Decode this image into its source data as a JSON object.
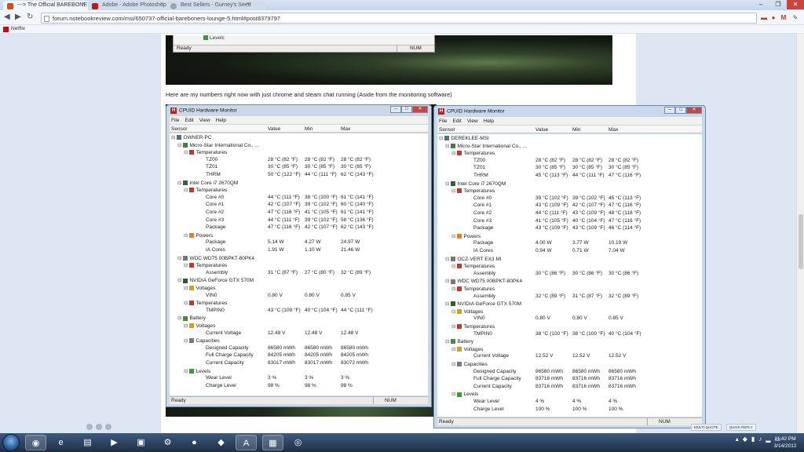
{
  "browser": {
    "tabs": [
      {
        "label": "---> The Official BAREBONE"
      },
      {
        "label": "Adobe - Adobe Photoshop"
      },
      {
        "label": "Best Sellers - Gurney's Seed"
      }
    ],
    "url": "forum.notebookreview.com/msi/650737-official-bareboners-lounge-5.html#post8379797",
    "bookmark": "Netflix"
  },
  "top_window": {
    "tree_item": "Levels",
    "status": "Ready",
    "num": "NUM"
  },
  "post_text": "Here are my numbers right now with just chrome and steam chat running (Aside from the monitoring software)",
  "hwm_title": "CPUID Hardware Monitor",
  "menu": [
    "File",
    "Edit",
    "View",
    "Help"
  ],
  "columns": {
    "sensor": "Sensor",
    "value": "Value",
    "min": "Min",
    "max": "Max"
  },
  "left_monitor": {
    "status": "Ready",
    "num": "NUM",
    "rows": [
      {
        "l": 0,
        "icon": "pc",
        "name": "OWNER-PC",
        "v": "",
        "mn": "",
        "mx": ""
      },
      {
        "l": 1,
        "icon": "mb",
        "name": "Micro-Star International Co., ...",
        "v": "",
        "mn": "",
        "mx": ""
      },
      {
        "l": 2,
        "icon": "temp",
        "name": "Temperatures",
        "v": "",
        "mn": "",
        "mx": ""
      },
      {
        "l": 3,
        "icon": "",
        "name": "TZ00",
        "v": "28 °C  (82 °F)",
        "mn": "28 °C  (82 °F)",
        "mx": "28 °C  (82 °F)"
      },
      {
        "l": 3,
        "icon": "",
        "name": "TZ01",
        "v": "30 °C  (85 °F)",
        "mn": "30 °C  (85 °F)",
        "mx": "30 °C  (85 °F)"
      },
      {
        "l": 3,
        "icon": "",
        "name": "THRM",
        "v": "50 °C  (122 °F)",
        "mn": "44 °C  (111 °F)",
        "mx": "62 °C  (143 °F)"
      },
      {
        "l": 1,
        "icon": "cpu",
        "name": "Intel Core i7 2670QM",
        "v": "",
        "mn": "",
        "mx": ""
      },
      {
        "l": 2,
        "icon": "temp",
        "name": "Temperatures",
        "v": "",
        "mn": "",
        "mx": ""
      },
      {
        "l": 3,
        "icon": "",
        "name": "Core #0",
        "v": "44 °C  (111 °F)",
        "mn": "38 °C  (100 °F)",
        "mx": "61 °C  (141 °F)"
      },
      {
        "l": 3,
        "icon": "",
        "name": "Core #1",
        "v": "42 °C  (107 °F)",
        "mn": "39 °C  (102 °F)",
        "mx": "60 °C  (140 °F)"
      },
      {
        "l": 3,
        "icon": "",
        "name": "Core #2",
        "v": "47 °C  (116 °F)",
        "mn": "41 °C  (105 °F)",
        "mx": "61 °C  (141 °F)"
      },
      {
        "l": 3,
        "icon": "",
        "name": "Core #3",
        "v": "44 °C  (111 °F)",
        "mn": "39 °C  (102 °F)",
        "mx": "58 °C  (136 °F)"
      },
      {
        "l": 3,
        "icon": "",
        "name": "Package",
        "v": "47 °C  (116 °F)",
        "mn": "42 °C  (107 °F)",
        "mx": "62 °C  (143 °F)"
      },
      {
        "l": 2,
        "icon": "power",
        "name": "Powers",
        "v": "",
        "mn": "",
        "mx": ""
      },
      {
        "l": 3,
        "icon": "",
        "name": "Package",
        "v": "5.14 W",
        "mn": "4.27 W",
        "mx": "24.97 W"
      },
      {
        "l": 3,
        "icon": "",
        "name": "IA Cores",
        "v": "1.91 W",
        "mn": "1.10 W",
        "mx": "21.46 W"
      },
      {
        "l": 1,
        "icon": "hdd",
        "name": "WDC WD75 00BPKT-80PK4",
        "v": "",
        "mn": "",
        "mx": ""
      },
      {
        "l": 2,
        "icon": "temp",
        "name": "Temperatures",
        "v": "",
        "mn": "",
        "mx": ""
      },
      {
        "l": 3,
        "icon": "",
        "name": "Assembly",
        "v": "31 °C  (87 °F)",
        "mn": "27 °C  (80 °F)",
        "mx": "32 °C  (89 °F)"
      },
      {
        "l": 1,
        "icon": "gpu",
        "name": "NVIDIA GeForce GTX 570M",
        "v": "",
        "mn": "",
        "mx": ""
      },
      {
        "l": 2,
        "icon": "volt",
        "name": "Voltages",
        "v": "",
        "mn": "",
        "mx": ""
      },
      {
        "l": 3,
        "icon": "",
        "name": "VIN0",
        "v": "0.80 V",
        "mn": "0.80 V",
        "mx": "0.85 V"
      },
      {
        "l": 2,
        "icon": "temp",
        "name": "Temperatures",
        "v": "",
        "mn": "",
        "mx": ""
      },
      {
        "l": 3,
        "icon": "",
        "name": "TMPIN0",
        "v": "43 °C  (109 °F)",
        "mn": "40 °C  (104 °F)",
        "mx": "44 °C  (111 °F)"
      },
      {
        "l": 1,
        "icon": "batt",
        "name": "Battery",
        "v": "",
        "mn": "",
        "mx": ""
      },
      {
        "l": 2,
        "icon": "volt",
        "name": "Voltages",
        "v": "",
        "mn": "",
        "mx": ""
      },
      {
        "l": 3,
        "icon": "",
        "name": "Current Voltage",
        "v": "12.48 V",
        "mn": "12.48 V",
        "mx": "12.48 V"
      },
      {
        "l": 2,
        "icon": "cap",
        "name": "Capacities",
        "v": "",
        "mn": "",
        "mx": ""
      },
      {
        "l": 3,
        "icon": "",
        "name": "Designed Capacity",
        "v": "86580 mWh",
        "mn": "86580 mWh",
        "mx": "86580 mWh"
      },
      {
        "l": 3,
        "icon": "",
        "name": "Full Charge Capacity",
        "v": "84205 mWh",
        "mn": "84205 mWh",
        "mx": "84205 mWh"
      },
      {
        "l": 3,
        "icon": "",
        "name": "Current Capacity",
        "v": "83017 mWh",
        "mn": "83017 mWh",
        "mx": "83072 mWh"
      },
      {
        "l": 2,
        "icon": "lvl",
        "name": "Levels",
        "v": "",
        "mn": "",
        "mx": ""
      },
      {
        "l": 3,
        "icon": "",
        "name": "Wear Level",
        "v": "3 %",
        "mn": "3 %",
        "mx": "3 %"
      },
      {
        "l": 3,
        "icon": "",
        "name": "Charge Level",
        "v": "98 %",
        "mn": "98 %",
        "mx": "98 %"
      }
    ]
  },
  "right_monitor": {
    "status": "Ready",
    "num": "NUM",
    "rows": [
      {
        "l": 0,
        "icon": "pc",
        "name": "DEREKLEE-MSI",
        "v": "",
        "mn": "",
        "mx": ""
      },
      {
        "l": 1,
        "icon": "mb",
        "name": "Micro-Star International Co., ...",
        "v": "",
        "mn": "",
        "mx": ""
      },
      {
        "l": 2,
        "icon": "temp",
        "name": "Temperatures",
        "v": "",
        "mn": "",
        "mx": ""
      },
      {
        "l": 3,
        "icon": "",
        "name": "TZ00",
        "v": "28 °C  (82 °F)",
        "mn": "28 °C  (82 °F)",
        "mx": "28 °C  (82 °F)"
      },
      {
        "l": 3,
        "icon": "",
        "name": "TZ01",
        "v": "30 °C  (85 °F)",
        "mn": "30 °C  (85 °F)",
        "mx": "30 °C  (85 °F)"
      },
      {
        "l": 3,
        "icon": "",
        "name": "THRM",
        "v": "45 °C  (113 °F)",
        "mn": "44 °C  (111 °F)",
        "mx": "47 °C  (116 °F)"
      },
      {
        "l": 1,
        "icon": "cpu",
        "name": "Intel Core i7 2670QM",
        "v": "",
        "mn": "",
        "mx": ""
      },
      {
        "l": 2,
        "icon": "temp",
        "name": "Temperatures",
        "v": "",
        "mn": "",
        "mx": ""
      },
      {
        "l": 3,
        "icon": "",
        "name": "Core #0",
        "v": "39 °C  (102 °F)",
        "mn": "39 °C  (102 °F)",
        "mx": "45 °C  (113 °F)"
      },
      {
        "l": 3,
        "icon": "",
        "name": "Core #1",
        "v": "43 °C  (109 °F)",
        "mn": "42 °C  (107 °F)",
        "mx": "47 °C  (116 °F)"
      },
      {
        "l": 3,
        "icon": "",
        "name": "Core #2",
        "v": "44 °C  (111 °F)",
        "mn": "43 °C  (109 °F)",
        "mx": "48 °C  (118 °F)"
      },
      {
        "l": 3,
        "icon": "",
        "name": "Core #3",
        "v": "41 °C  (105 °F)",
        "mn": "40 °C  (104 °F)",
        "mx": "47 °C  (116 °F)"
      },
      {
        "l": 3,
        "icon": "",
        "name": "Package",
        "v": "43 °C  (109 °F)",
        "mn": "43 °C  (109 °F)",
        "mx": "46 °C  (114 °F)"
      },
      {
        "l": 2,
        "icon": "power",
        "name": "Powers",
        "v": "",
        "mn": "",
        "mx": ""
      },
      {
        "l": 3,
        "icon": "",
        "name": "Package",
        "v": "4.00 W",
        "mn": "3.77 W",
        "mx": "10.19 W"
      },
      {
        "l": 3,
        "icon": "",
        "name": "IA Cores",
        "v": "0.94 W",
        "mn": "0.71 W",
        "mx": "7.04 W"
      },
      {
        "l": 1,
        "icon": "hdd",
        "name": "OCZ-VERT EX3 MI",
        "v": "",
        "mn": "",
        "mx": ""
      },
      {
        "l": 2,
        "icon": "temp",
        "name": "Temperatures",
        "v": "",
        "mn": "",
        "mx": ""
      },
      {
        "l": 3,
        "icon": "",
        "name": "Assembly",
        "v": "30 °C  (86 °F)",
        "mn": "30 °C  (86 °F)",
        "mx": "30 °C  (86 °F)"
      },
      {
        "l": 1,
        "icon": "hdd",
        "name": "WDC WD75 00BPKT-80PK4",
        "v": "",
        "mn": "",
        "mx": ""
      },
      {
        "l": 2,
        "icon": "temp",
        "name": "Temperatures",
        "v": "",
        "mn": "",
        "mx": ""
      },
      {
        "l": 3,
        "icon": "",
        "name": "Assembly",
        "v": "32 °C  (89 °F)",
        "mn": "31 °C  (87 °F)",
        "mx": "32 °C  (89 °F)"
      },
      {
        "l": 1,
        "icon": "gpu",
        "name": "NVIDIA GeForce GTX 570M",
        "v": "",
        "mn": "",
        "mx": ""
      },
      {
        "l": 2,
        "icon": "volt",
        "name": "Voltages",
        "v": "",
        "mn": "",
        "mx": ""
      },
      {
        "l": 3,
        "icon": "",
        "name": "VIN0",
        "v": "0.80 V",
        "mn": "0.80 V",
        "mx": "0.85 V"
      },
      {
        "l": 2,
        "icon": "temp",
        "name": "Temperatures",
        "v": "",
        "mn": "",
        "mx": ""
      },
      {
        "l": 3,
        "icon": "",
        "name": "TMPIN0",
        "v": "38 °C  (100 °F)",
        "mn": "38 °C  (100 °F)",
        "mx": "40 °C  (104 °F)"
      },
      {
        "l": 1,
        "icon": "batt",
        "name": "Battery",
        "v": "",
        "mn": "",
        "mx": ""
      },
      {
        "l": 2,
        "icon": "volt",
        "name": "Voltages",
        "v": "",
        "mn": "",
        "mx": ""
      },
      {
        "l": 3,
        "icon": "",
        "name": "Current Voltage",
        "v": "12.52 V",
        "mn": "12.52 V",
        "mx": "12.52 V"
      },
      {
        "l": 2,
        "icon": "cap",
        "name": "Capacities",
        "v": "",
        "mn": "",
        "mx": ""
      },
      {
        "l": 3,
        "icon": "",
        "name": "Designed Capacity",
        "v": "86580 mWh",
        "mn": "86580 mWh",
        "mx": "86580 mWh"
      },
      {
        "l": 3,
        "icon": "",
        "name": "Full Charge Capacity",
        "v": "83716 mWh",
        "mn": "83716 mWh",
        "mx": "83716 mWh"
      },
      {
        "l": 3,
        "icon": "",
        "name": "Current Capacity",
        "v": "83716 mWh",
        "mn": "83716 mWh",
        "mx": "83716 mWh"
      },
      {
        "l": 2,
        "icon": "lvl",
        "name": "Levels",
        "v": "",
        "mn": "",
        "mx": ""
      },
      {
        "l": 3,
        "icon": "",
        "name": "Wear Level",
        "v": "4 %",
        "mn": "4 %",
        "mx": "4 %"
      },
      {
        "l": 3,
        "icon": "",
        "name": "Charge Level",
        "v": "100 %",
        "mn": "100 %",
        "mx": "100 %"
      }
    ]
  },
  "reply_buttons": [
    "MULTI-QUOTE",
    "QUICK REPLY"
  ],
  "clock": {
    "time": "11:42 PM",
    "date": "3/14/2012"
  },
  "icon_colors": {
    "temp": "#c0392b",
    "power": "#e67e22",
    "volt": "#c9a227",
    "cap": "#7a7a7a",
    "lvl": "#3a9a3a",
    "pc": "#5a6c80",
    "mb": "#4a7a4a",
    "cpu": "#3b5f3b",
    "hdd": "#777777",
    "gpu": "#2e5e2e",
    "batt": "#4a8a3a"
  },
  "taskbar_apps": [
    "start-orb",
    "chrome",
    "ie",
    "explorer",
    "media",
    "steam",
    "app-red",
    "nvidia",
    "acrobat",
    "notepad",
    "app"
  ]
}
